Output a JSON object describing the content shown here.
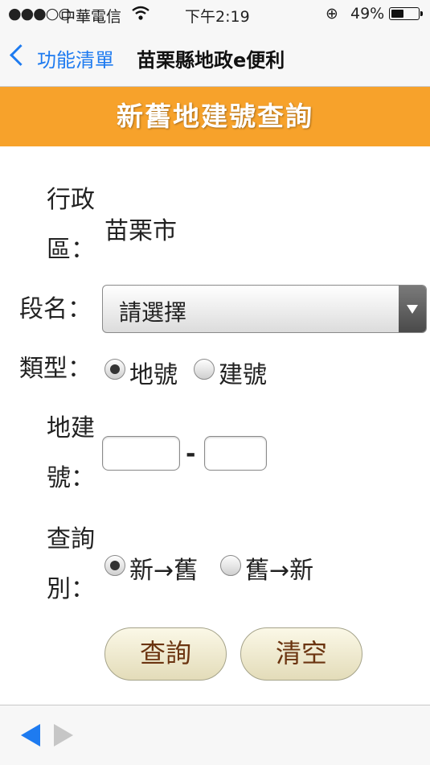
{
  "status_bar": {
    "signal": "●●●○○",
    "carrier": "中華電信",
    "wifi_icon": "wifi-icon",
    "time": "下午2:19",
    "lock_icon": "⊕",
    "battery_percent": "49%",
    "battery_level": 0.49
  },
  "nav": {
    "back_label": "功能清單",
    "title": "苗栗縣地政e便利"
  },
  "banner": {
    "title": "新舊地建號查詢"
  },
  "form": {
    "district": {
      "label_line1": "行政",
      "label_line2": "區：",
      "value": "苗栗市"
    },
    "section": {
      "label": "段名：",
      "selected": "請選擇"
    },
    "type": {
      "label": "類型：",
      "options": [
        {
          "label": "地號",
          "checked": true
        },
        {
          "label": "建號",
          "checked": false
        }
      ]
    },
    "number": {
      "label_line1": "地建",
      "label_line2": "號：",
      "separator": "-",
      "value1": "",
      "value2": ""
    },
    "direction": {
      "label_line1": "查詢",
      "label_line2": "別：",
      "options": [
        {
          "label": "新→舊",
          "checked": true
        },
        {
          "label": "舊→新",
          "checked": false
        }
      ]
    }
  },
  "buttons": {
    "query": "查詢",
    "clear": "清空"
  },
  "colors": {
    "accent": "#1e7bf0",
    "banner": "#f7a22b",
    "button_text": "#6b3410"
  }
}
